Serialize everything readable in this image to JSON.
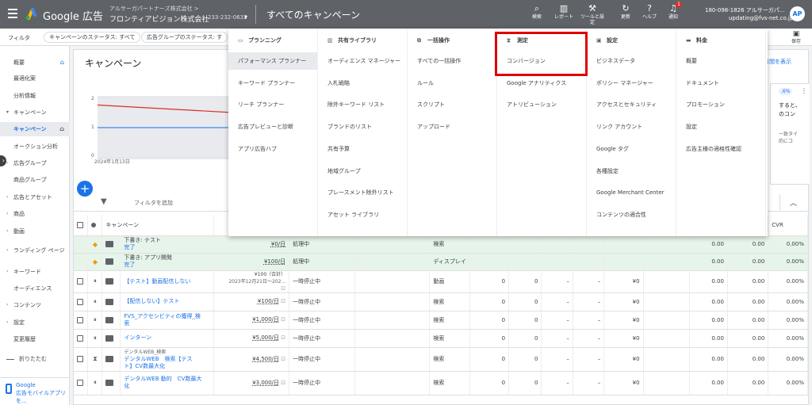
{
  "header": {
    "app_title": "Google 広告",
    "account_sub": "アルサーガパートナーズ株式会社 >",
    "account_main": "フロンティアビジョン株式会社",
    "account_id": "233-232-0632",
    "page": "すべてのキャンペーン",
    "tools": [
      "検索",
      "レポート",
      "ツールと設定",
      "更新",
      "ヘルプ",
      "通知"
    ],
    "notif_count": "1",
    "customer_phone": "180-098-1826 アルサーガパ...",
    "customer_email": "updating@fvs-net.co.jp",
    "avatar": "AP"
  },
  "filterbar": {
    "label": "フィルタ",
    "chips": [
      "キャンペーンのステータス: すべて",
      "広告グループのステータス: す"
    ],
    "save": "保存"
  },
  "sidebar": {
    "items": [
      "概要",
      "最適化案",
      "分析情報",
      "キャンペーン",
      "キャンペーン",
      "オークション分析",
      "広告グループ",
      "商品グループ",
      "広告とアセット",
      "商品",
      "動画",
      "ランディング ページ",
      "キーワード",
      "オーディエンス",
      "コンテンツ",
      "設定",
      "変更履歴"
    ],
    "collapse": "折りたたむ",
    "promo_1": "Google",
    "promo_2": "広告モバイルアプリを..."
  },
  "main": {
    "title": "キャンペーン",
    "show_link": "日間を表示",
    "chart_date": "2024年1月13日",
    "y_ticks": [
      "2",
      "1",
      "0"
    ],
    "card_pct": ".6%",
    "card_lines": [
      "すると、",
      "のコン"
    ],
    "card_small": [
      "ー致タイ",
      "的にコ"
    ],
    "filter_add": "フィルタを追加",
    "seg_stub": "自"
  },
  "chart_data": {
    "type": "line",
    "x": [
      "2024年1月13日",
      ""
    ],
    "ylim": [
      0,
      2
    ],
    "series": [
      {
        "values": [
          1.75,
          1.5
        ],
        "color": "#d93025"
      },
      {
        "values": [
          1,
          1
        ],
        "color": "#4285f4"
      }
    ]
  },
  "table": {
    "headers": [
      "キャンペーン",
      "CVR"
    ],
    "rows": [
      {
        "kind": "draft",
        "name": "下書き: テスト",
        "sub": "完了",
        "budget": "¥0/日",
        "status": "処理中",
        "type": "検索",
        "n1": "",
        "n2": "",
        "n3": "",
        "n4": "",
        "n5": "",
        "c1": "0.00",
        "c2": "0.00",
        "cvr": "0.00%"
      },
      {
        "kind": "draft",
        "name": "下書き: アプリ開発",
        "sub": "完了",
        "budget": "¥100/日",
        "status": "処理中",
        "type": "ディスプレイ",
        "n1": "",
        "n2": "",
        "n3": "",
        "n4": "",
        "n5": "",
        "c1": "0.00",
        "c2": "0.00",
        "cvr": "0.00%"
      },
      {
        "kind": "row",
        "name": "【テスト】動画配信しない",
        "sub": "",
        "budget": "¥100（合計）",
        "budget2": "2023年12月21日〜202...",
        "status": "一時停止中",
        "type": "動画",
        "n1": "0",
        "n2": "0",
        "n3": "–",
        "n4": "–",
        "n5": "¥0",
        "c1": "0.00",
        "c2": "0.00",
        "cvr": "0.00%"
      },
      {
        "kind": "row",
        "name": "【配信しない】テスト",
        "sub": "",
        "budget": "¥100/日",
        "status": "一時停止中",
        "type": "検索",
        "n1": "0",
        "n2": "0",
        "n3": "–",
        "n4": "–",
        "n5": "¥0",
        "c1": "0.00",
        "c2": "0.00",
        "cvr": "0.00%"
      },
      {
        "kind": "row",
        "name": "FVS_アクセシビティの獲得_検",
        "name2": "索",
        "sub": "",
        "budget": "¥1,000/日",
        "status": "一時停止中",
        "type": "検索",
        "n1": "0",
        "n2": "0",
        "n3": "–",
        "n4": "–",
        "n5": "¥0",
        "c1": "0.00",
        "c2": "0.00",
        "cvr": "0.00%"
      },
      {
        "kind": "row",
        "name": "インターン",
        "sub": "",
        "budget": "¥5,000/日",
        "status": "一時停止中",
        "type": "検索",
        "n1": "0",
        "n2": "0",
        "n3": "–",
        "n4": "–",
        "n5": "¥0",
        "c1": "0.00",
        "c2": "0.00",
        "cvr": "0.00%"
      },
      {
        "kind": "tall",
        "pre": "デンタルWEB_検索",
        "name": "デンタルWEB　検索【テス",
        "name2": "ト】CV数最大化",
        "sub": "",
        "budget": "¥4,500/日",
        "status": "一時停止中",
        "type": "検索",
        "n1": "0",
        "n2": "0",
        "n3": "–",
        "n4": "–",
        "n5": "¥0",
        "c1": "0.00",
        "c2": "0.00",
        "cvr": "0.00%"
      },
      {
        "kind": "tall",
        "name": "デンタルWEB 動的　CV数最大",
        "name2": "化",
        "sub": "",
        "budget": "¥3,000/日",
        "status": "一時停止中",
        "type": "検索",
        "n1": "0",
        "n2": "0",
        "n3": "–",
        "n4": "–",
        "n5": "¥0",
        "c1": "0.00",
        "c2": "0.00",
        "cvr": "0.00%"
      }
    ]
  },
  "dropdown": {
    "columns": [
      {
        "icon": "▭",
        "title": "プランニング",
        "items": [
          "パフォーマンス プランナー",
          "キーワード プランナー",
          "リーチ プランナー",
          "広告プレビューと診断",
          "アプリ広告ハブ"
        ]
      },
      {
        "icon": "▥",
        "title": "共有ライブラリ",
        "items": [
          "オーディエンス マネージャー",
          "入札戦略",
          "除外キーワード リスト",
          "ブランドのリスト",
          "共有予算",
          "地域グループ",
          "プレースメント除外リスト",
          "アセット ライブラリ"
        ]
      },
      {
        "icon": "⧉",
        "title": "一括操作",
        "items": [
          "すべての一括操作",
          "ルール",
          "スクリプト",
          "アップロード"
        ]
      },
      {
        "icon": "⧗",
        "title": "測定",
        "items": [
          "コンバージョン",
          "Google アナリティクス",
          "アトリビューション"
        ]
      },
      {
        "icon": "▣",
        "title": "設定",
        "items": [
          "ビジネスデータ",
          "ポリシー マネージャー",
          "アクセスとセキュリティ",
          "リンク アカウント",
          "Google タグ",
          "各種設定",
          "Google Merchant Center",
          "コンテンツの適合性"
        ]
      },
      {
        "icon": "▬",
        "title": "料金",
        "items": [
          "概要",
          "ドキュメント",
          "プロモーション",
          "設定",
          "広告主様の適格性確認"
        ]
      }
    ]
  }
}
